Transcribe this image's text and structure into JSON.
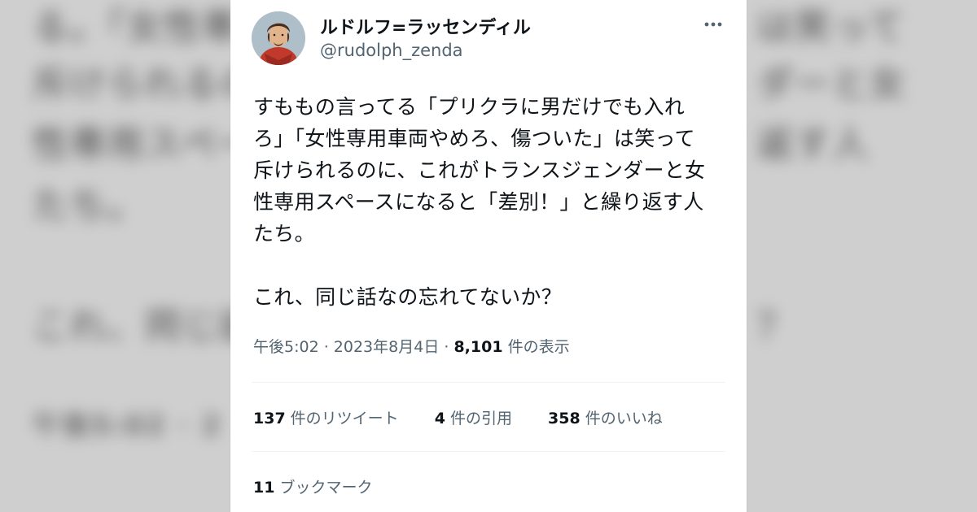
{
  "background": {
    "blurred_lines": [
      "る。「女性専用",
      "斥けられるのに",
      "性専用スペース",
      "たち。",
      "これ、同じ話",
      "午後5:02 · 2"
    ],
    "blurred_right_lines": [
      "は笑って",
      "ダーと女",
      "返す人",
      "？"
    ]
  },
  "tweet": {
    "author": {
      "display_name": "ルドルフ=ラッセンディル",
      "handle": "@rudolph_zenda",
      "avatar_icon": "user-avatar-illustration"
    },
    "more_icon": "more-horizontal-icon",
    "text": "すももの言ってる「プリクラに男だけでも入れろ」「女性専用車両やめろ、傷ついた」は笑って斥けられるのに、これがトランスジェンダーと女性専用スペースになると「差別！」と繰り返す人たち。\n\nこれ、同じ話なの忘れてないか？",
    "time": "午後5:02",
    "sep1": " · ",
    "date": "2023年8月4日",
    "sep2": " · ",
    "views_count": "8,101",
    "views_label": " 件の表示",
    "stats": {
      "retweets_count": "137",
      "retweets_label": "件のリツイート",
      "quotes_count": "4",
      "quotes_label": "件の引用",
      "likes_count": "358",
      "likes_label": "件のいいね"
    },
    "bookmarks": {
      "count": "11",
      "label": "ブックマーク"
    }
  },
  "colors": {
    "text_primary": "#0f1419",
    "text_secondary": "#536471",
    "divider": "#eff3f4"
  }
}
